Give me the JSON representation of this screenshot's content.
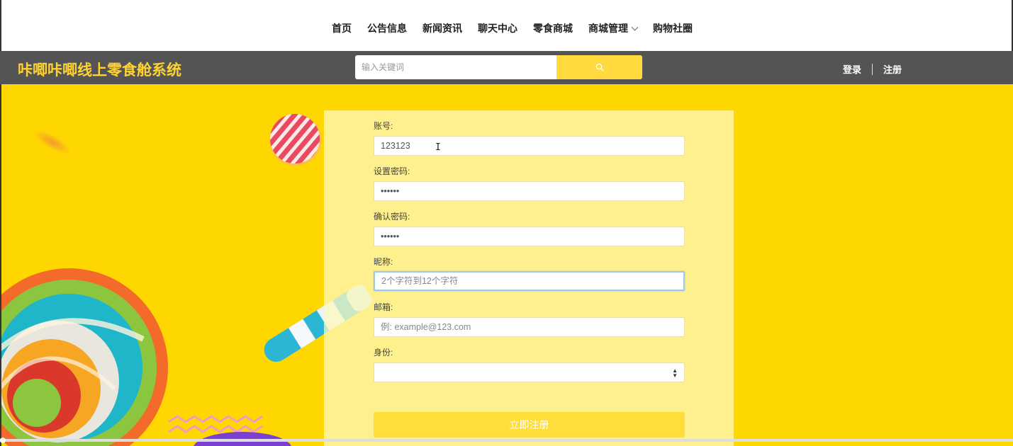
{
  "nav": {
    "items": [
      "首页",
      "公告信息",
      "新闻资讯",
      "聊天中心",
      "零食商城",
      "商城管理",
      "购物社圈"
    ]
  },
  "header": {
    "site_title": "咔唧咔唧线上零食舱系统",
    "search_placeholder": "输入关键词",
    "login": "登录",
    "register": "注册"
  },
  "form": {
    "account_label": "账号:",
    "account_value": "123123",
    "password_label": "设置密码:",
    "password_value": "••••••",
    "confirm_label": "确认密码:",
    "confirm_value": "••••••",
    "nickname_label": "昵称:",
    "nickname_placeholder": "2个字符到12个字符",
    "email_label": "邮箱:",
    "email_placeholder": "例: example@123.com",
    "role_label": "身份:",
    "role_value": "",
    "submit_label": "立即注册"
  },
  "colors": {
    "accent": "#ffd700",
    "header_bg": "#545454",
    "logo": "#ffd233",
    "button": "#ffde3c"
  },
  "icons": [
    "search-icon",
    "chevron-down-icon",
    "select-arrows-icon"
  ]
}
